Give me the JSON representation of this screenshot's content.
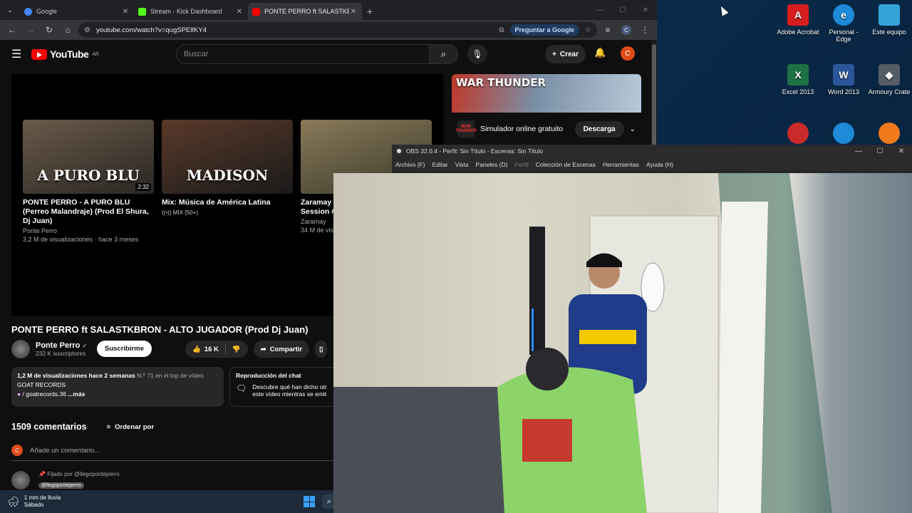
{
  "browser": {
    "tabs": [
      {
        "label": "Google",
        "color": "#4285f4"
      },
      {
        "label": "Stream - Kick Dashboard",
        "color": "#53fc18"
      },
      {
        "label": "PONTE PERRO ft SALASTKBRON",
        "color": "#ff0000"
      }
    ],
    "url": "youtube.com/watch?v=qugSPElfKY4",
    "ask_google": "Preguntar a Google",
    "profile_initial": "C"
  },
  "youtube": {
    "logo": "YouTube",
    "logo_region": "AR",
    "search_placeholder": "Buscar",
    "create_label": "Crear",
    "profile_initial": "C",
    "endcards": [
      {
        "thumb_text": "A PURO BLU",
        "duration": "2:32",
        "title": "PONTE PERRO - A PURO BLU (Perreo Malandraje) (Prod El Shura, Dj Juan)",
        "channel": "Ponte Perro",
        "meta": "3,2 M de visualizaciones · hace 3 meses"
      },
      {
        "thumb_text": "MADISON",
        "title": "Mix: Música de América Latina",
        "mix": "MIX (50+)"
      },
      {
        "title": "Zaramay",
        "title2": "Session #",
        "channel": "Zaramay",
        "meta": "34 M de vis"
      }
    ],
    "ad": {
      "banner_text": "WAR THUNDER",
      "logo_text": "WAR THUNDER",
      "title": "Simulador online gratuito",
      "cta": "Descarga"
    },
    "video_title": "PONTE PERRO ft SALASTKBRON - ALTO JUGADOR (Prod Dj Juan)",
    "channel": {
      "name": "Ponte Perro",
      "subs": "232 K suscriptores",
      "subscribe_label": "Suscribirme"
    },
    "likes": "16 K",
    "share_label": "Compartir",
    "description": {
      "views": "1,2 M de visualizaciones",
      "ago": "hace 2 semanas",
      "rank": "N.º 71 en el top de vídeo",
      "label": "GOAT RECORDS",
      "link": "/ goatrecords.36",
      "more": "...más"
    },
    "chat_replay": {
      "title": "Reproducción del chat",
      "text": "Descubre qué han dicho otr este vídeo mientras se emit"
    },
    "comments_count": "1509 comentarios",
    "sort_label": "Ordenar por",
    "add_comment": "Añade un comentario...",
    "pinned_by": "Fijado por @llegoponteperro",
    "pinned_tag": "@llegoponteperro"
  },
  "obs": {
    "title": "OBS 32.0.4 - Perfil: Sin Título - Escenas: Sin Título",
    "menu": [
      "Archivo (F)",
      "Editar",
      "Vista",
      "Paneles (D)",
      "Perfil",
      "Colección de Escenas",
      "Herramientas",
      "Ayuda (H)"
    ]
  },
  "taskbar": {
    "weather_title": "1 mm de lluvia",
    "weather_sub": "Sábado"
  },
  "desktop_icons": [
    {
      "label": "Adobe Acrobat",
      "color": "#d71e1e",
      "glyph": "A"
    },
    {
      "label": "Personal - Edge",
      "color": "#1f8ad8",
      "glyph": "e"
    },
    {
      "label": "Este equipo",
      "color": "#34a4d8",
      "glyph": "■"
    },
    {
      "label": "Excel 2013",
      "color": "#1e7145",
      "glyph": "X"
    },
    {
      "label": "Word 2013",
      "color": "#2b579a",
      "glyph": "W"
    },
    {
      "label": "Armoury Crate",
      "color": "#555d66",
      "glyph": "◆"
    }
  ]
}
